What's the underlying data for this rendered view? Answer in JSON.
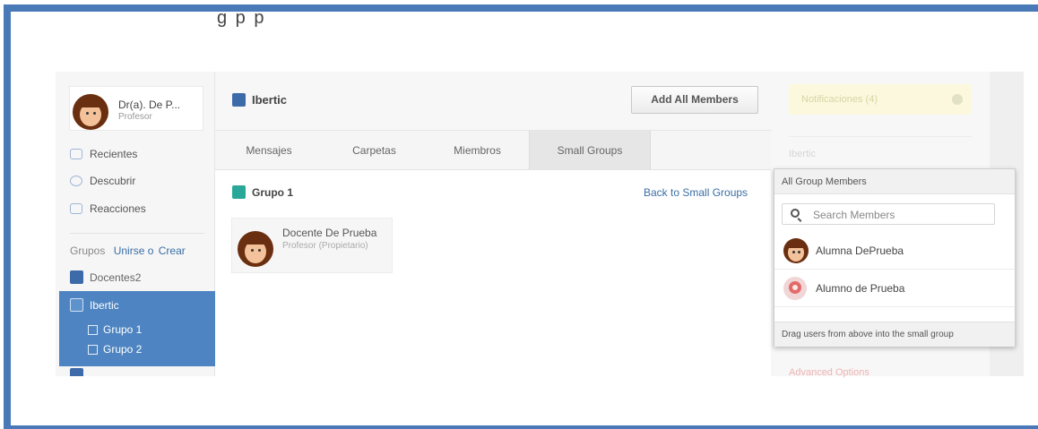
{
  "colors": {
    "frame": "#4a79b8",
    "accent": "#3d6aa8",
    "active_group": "#4d84c1",
    "group1": "#29a89a",
    "link": "#3a6ea5"
  },
  "top_cut_text": "g p p",
  "profile": {
    "name": "Dr(a). De P...",
    "role": "Profesor"
  },
  "nav": [
    {
      "label": "Recientes",
      "icon": "chat-bubble-icon"
    },
    {
      "label": "Descubrir",
      "icon": "compass-icon"
    },
    {
      "label": "Reacciones",
      "icon": "reactions-icon"
    }
  ],
  "groups_header": {
    "label": "Grupos",
    "join": "Unirse o",
    "create": "Crear"
  },
  "groups": [
    {
      "label": "Docentes2"
    },
    {
      "label": "Ibertic",
      "subgroups": [
        "Grupo 1",
        "Grupo 2"
      ]
    }
  ],
  "main": {
    "title": "Ibertic",
    "add_button": "Add All Members",
    "tabs": [
      "Mensajes",
      "Carpetas",
      "Miembros",
      "Small Groups"
    ],
    "active_tab": "Small Groups",
    "subgroup_title": "Grupo 1",
    "back_link": "Back to Small Groups",
    "member_card": {
      "name": "Docente De Prueba",
      "role": "Profesor (Propietario)"
    }
  },
  "right": {
    "notifications": "Notificaciones (4)",
    "faded_label": "Ibertic",
    "faded_bottom": "Advanced Options"
  },
  "popup": {
    "title": "All Group Members",
    "search_placeholder": "Search Members",
    "members": [
      {
        "name": "Alumna DePrueba",
        "avatar": "girl-avatar-icon"
      },
      {
        "name": "Alumno de Prueba",
        "avatar": "default-avatar-icon"
      }
    ],
    "footer": "Drag users from above into the small group"
  }
}
